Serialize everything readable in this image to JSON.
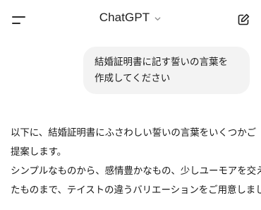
{
  "header": {
    "menu_icon": "menu-icon",
    "title": "ChatGPT",
    "dropdown_icon": "chevron-down-icon",
    "new_chat_icon": "edit-icon"
  },
  "conversation": {
    "user_message": {
      "lines": [
        "結婚証明書に記す誓いの言葉を",
        "作成してください"
      ]
    },
    "assistant_message": {
      "lines": [
        "以下に、結婚証明書にふさわしい誓いの言葉をいくつかご",
        "提案します。",
        "シンプルなものから、感情豊かなもの、少しユーモアを交え",
        "たものまで、テイストの違うバリエーションをご用意しました。"
      ]
    }
  }
}
